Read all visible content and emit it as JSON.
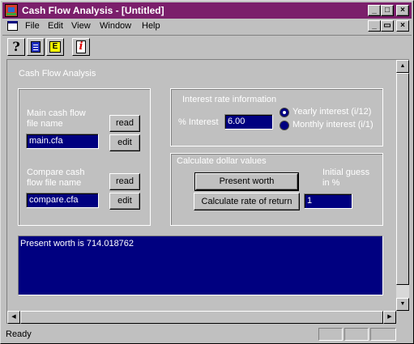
{
  "window": {
    "title": "Cash Flow Analysis - [Untitled]"
  },
  "title_buttons": {
    "minimize": "_",
    "maximize": "□",
    "close": "×"
  },
  "mdi_buttons": {
    "minimize": "_",
    "restore": "▭",
    "close": "×"
  },
  "menu": [
    "File",
    "Edit",
    "View",
    "Window",
    "Help"
  ],
  "toolbar": {
    "help_glyph": "?",
    "e_glyph": "E",
    "info_glyph": "i",
    "icons": [
      "help-icon",
      "list-icon",
      "e-icon",
      "info-icon"
    ]
  },
  "panel": {
    "title": "Cash Flow Analysis",
    "main_label_line1": "Main cash flow",
    "main_label_line2": "file name",
    "main_file": "main.cfa",
    "compare_label_line1": "Compare cash",
    "compare_label_line2": "flow file name",
    "compare_file": "compare.cfa",
    "read_label": "read",
    "edit_label": "edit"
  },
  "interest": {
    "group_title": "Interest rate information",
    "percent_label": "% Interest",
    "value": "6.00",
    "yearly_label": "Yearly interest (i/12)",
    "monthly_label": "Monthly interest (i/1)",
    "selected": "yearly"
  },
  "calculate": {
    "group_title": "Calculate dollar values",
    "present_worth_label": "Present worth",
    "rate_of_return_label": "Calculate rate of return",
    "guess_label_line1": "Initial guess",
    "guess_label_line2": "in %",
    "guess_value": "1"
  },
  "output": {
    "text": "Present worth is 714.018762"
  },
  "status": {
    "text": "Ready"
  },
  "colors": {
    "title_bar": "#7b1f6b",
    "field_bg": "#000080",
    "face": "#c0c0c0"
  }
}
